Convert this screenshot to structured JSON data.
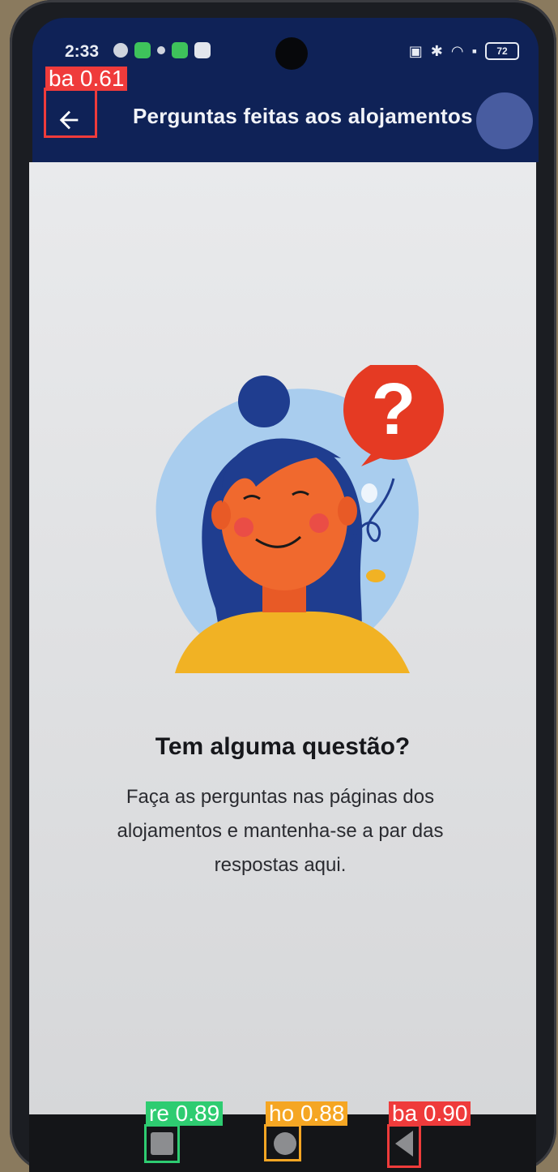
{
  "status_bar": {
    "time": "2:33",
    "battery": "72"
  },
  "app_bar": {
    "title": "Perguntas feitas aos alojamentos"
  },
  "empty_state": {
    "headline": "Tem alguma questão?",
    "body": "Faça as perguntas nas páginas dos alojamentos e mantenha-se a par das respostas aqui."
  },
  "detections": [
    {
      "label": "ba 0.61",
      "color": "#ef3b3b"
    },
    {
      "label": "re 0.89",
      "color": "#2ecc71"
    },
    {
      "label": "ho 0.88",
      "color": "#f5a623"
    },
    {
      "label": "ba 0.90",
      "color": "#ef3b3b"
    }
  ],
  "colors": {
    "app_bar": "#0f2257",
    "background": "#e9eaec",
    "accent_red": "#e53a23",
    "hair": "#1e3a8a",
    "skin": "#f0692e",
    "shirt": "#f1b224"
  }
}
